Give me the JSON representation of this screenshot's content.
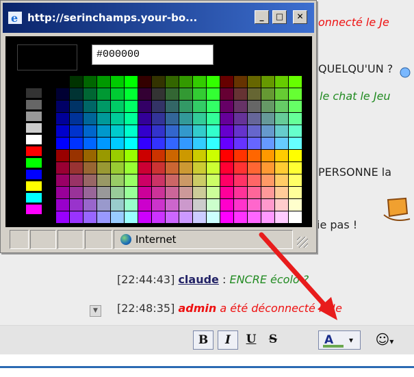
{
  "popup": {
    "title": "http://serinchamps.your-bo...",
    "minimize_label": "_",
    "maximize_label": "□",
    "close_label": "✕",
    "hex_value": "#000000",
    "preview_color": "#000000",
    "status_zone": "Internet"
  },
  "chat": {
    "lines": [
      {
        "text": "onnecté le Je",
        "style": "msg-red"
      },
      {
        "text": "QUELQU'UN ?",
        "style": "msg-dark"
      },
      {
        "text": "le chat le Jeu",
        "style": "msg-green"
      },
      {
        "text": "PERSONNE la",
        "style": "msg-dark"
      },
      {
        "text": "ie pas ! ",
        "style": "msg-dark"
      },
      {
        "time": "[22:44:43]",
        "user": "claude",
        "sep": " : ",
        "text": "ENCRE écolo ?",
        "style": "msg-green"
      },
      {
        "time": "[22:48:35]",
        "user": "admin",
        "text": " a été déconnecté le Je",
        "style": "msg-red"
      }
    ]
  },
  "toolbar": {
    "bold_label": "B",
    "italic_label": "I",
    "underline_label": "U",
    "strike_label": "S",
    "color_label": "A",
    "color_dropdown": "▾",
    "smiley_label": "☺",
    "smiley_dropdown": "▾"
  },
  "colors": {
    "arrow": "#e81c1c",
    "accent_bar": "#2b6ab3",
    "title_gradient_start": "#0a246a",
    "title_gradient_end": "#3d6fd0",
    "font_color_underline": "#6aa84f"
  },
  "palette": {
    "grays": [
      "#333333",
      "#666666",
      "#999999",
      "#cccccc",
      "#ffffff"
    ],
    "primaries": [
      "#ff0000",
      "#00ff00",
      "#0000ff",
      "#ffff00",
      "#00ffff",
      "#ff00ff"
    ]
  }
}
